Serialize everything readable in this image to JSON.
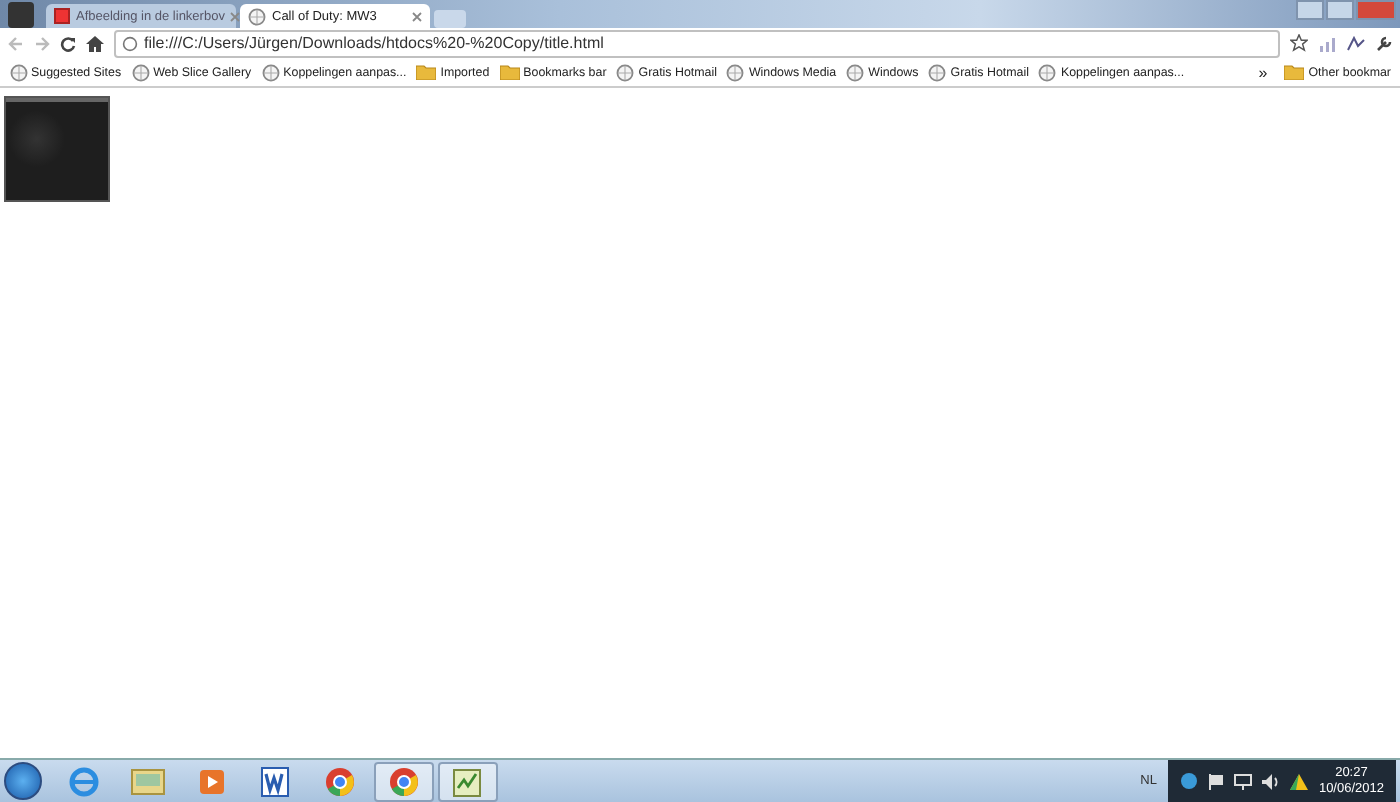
{
  "tabs": [
    {
      "label": "Afbeelding in de linkerbov",
      "selected": false,
      "kind": "image"
    },
    {
      "label": "Call of Duty: MW3",
      "selected": true,
      "kind": "page"
    }
  ],
  "toolbar": {
    "url": "file:///C:/Users/Jürgen/Downloads/htdocs%20-%20Copy/title.html"
  },
  "bookmarks": [
    {
      "label": "Suggested Sites",
      "kind": "site"
    },
    {
      "label": "Web Slice Gallery",
      "kind": "site"
    },
    {
      "label": "Koppelingen aanpas...",
      "kind": "site"
    },
    {
      "label": "Imported",
      "kind": "folder"
    },
    {
      "label": "Bookmarks bar",
      "kind": "folder"
    },
    {
      "label": "Gratis Hotmail",
      "kind": "site"
    },
    {
      "label": "Windows Media",
      "kind": "site"
    },
    {
      "label": "Windows",
      "kind": "site"
    },
    {
      "label": "Gratis Hotmail",
      "kind": "site"
    },
    {
      "label": "Koppelingen aanpas...",
      "kind": "site"
    }
  ],
  "bookmarks_overflow": "»",
  "other_bookmarks": "Other bookmar",
  "taskbar": {
    "apps": [
      {
        "kind": "ie",
        "active": false
      },
      {
        "kind": "explorer",
        "active": false
      },
      {
        "kind": "media",
        "active": false
      },
      {
        "kind": "word",
        "active": false
      },
      {
        "kind": "chrome",
        "active": false
      },
      {
        "kind": "chrome",
        "active": true
      },
      {
        "kind": "notepad",
        "active": true
      }
    ],
    "language": "NL",
    "time": "20:27",
    "date": "10/06/2012"
  }
}
